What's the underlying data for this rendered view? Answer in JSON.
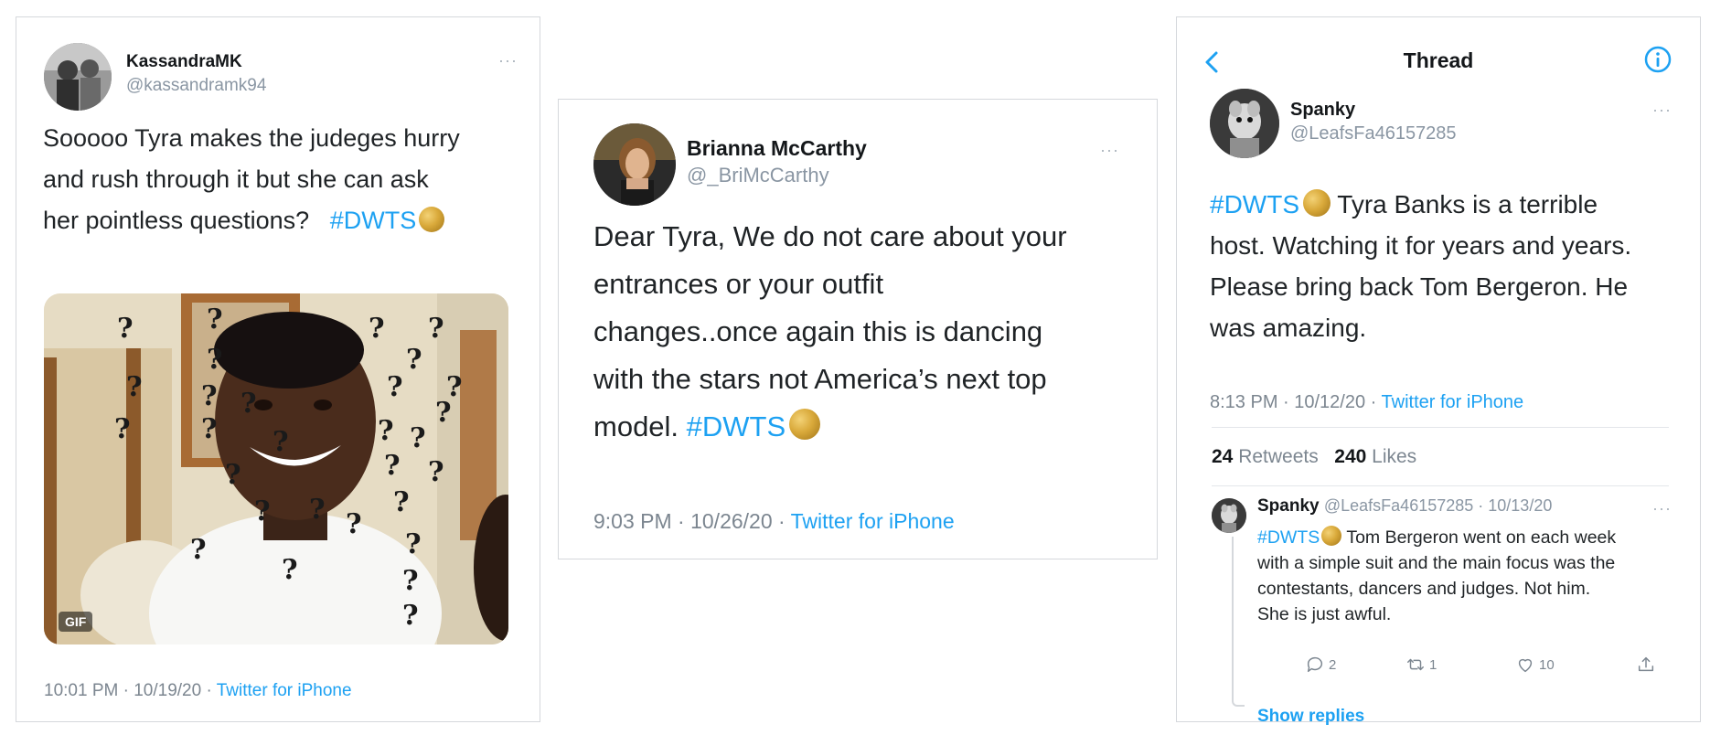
{
  "tweet1": {
    "name": "KassandraMK",
    "handle": "@kassandramk94",
    "more": "···",
    "text_line1": "Sooooo Tyra makes the judeges hurry",
    "text_line2": "and rush through it but she can ask",
    "text_line3": "her pointless questions?",
    "hashtag": "#DWTS",
    "emoji": "gold-medal-emoji",
    "gif_label": "GIF",
    "time": "10:01 PM · 10/19/20 · ",
    "source": "Twitter for iPhone"
  },
  "tweet2": {
    "name": "Brianna McCarthy",
    "handle": "@_BriMcCarthy",
    "more": "···",
    "text_line1": "Dear Tyra, We do not care about your",
    "text_line2": "entrances or your outfit",
    "text_line3": "changes..once again this is dancing",
    "text_line4": "with the stars not America’s next top",
    "text_line5": "model.",
    "hashtag": "#DWTS",
    "emoji": "gold-medal-emoji",
    "time": "9:03 PM · 10/26/20 · ",
    "source": "Twitter for iPhone"
  },
  "thread": {
    "title": "Thread",
    "back_icon": "chevron-left-icon",
    "info_icon": "info-icon",
    "tweet": {
      "name": "Spanky",
      "handle": "@LeafsFa46157285",
      "more": "···",
      "hashtag": "#DWTS",
      "text_line1_rest": " Tyra Banks is a terrible",
      "text_line2": "host. Watching it for years and years.",
      "text_line3": "Please bring back Tom Bergeron. He",
      "text_line4": "was amazing.",
      "time": "8:13 PM · 10/12/20 · ",
      "source": "Twitter for iPhone",
      "retweets_count": "24",
      "retweets_label": "Retweets",
      "likes_count": "240",
      "likes_label": "Likes"
    },
    "reply": {
      "name": "Spanky",
      "handle_date": "@LeafsFa46157285 · 10/13/20",
      "more": "···",
      "hashtag": "#DWTS",
      "text_line1_rest": " Tom Bergeron went on each week",
      "text_line2": "with a simple suit and the main focus was the",
      "text_line3": "contestants, dancers and judges. Not him.",
      "text_line4": "She is just awful.",
      "reply_count": "2",
      "retweet_count": "1",
      "like_count": "10",
      "show_replies": "Show replies"
    }
  },
  "colors": {
    "link": "#1da1f2",
    "muted": "#7c8690",
    "border": "#d5d8dc"
  }
}
